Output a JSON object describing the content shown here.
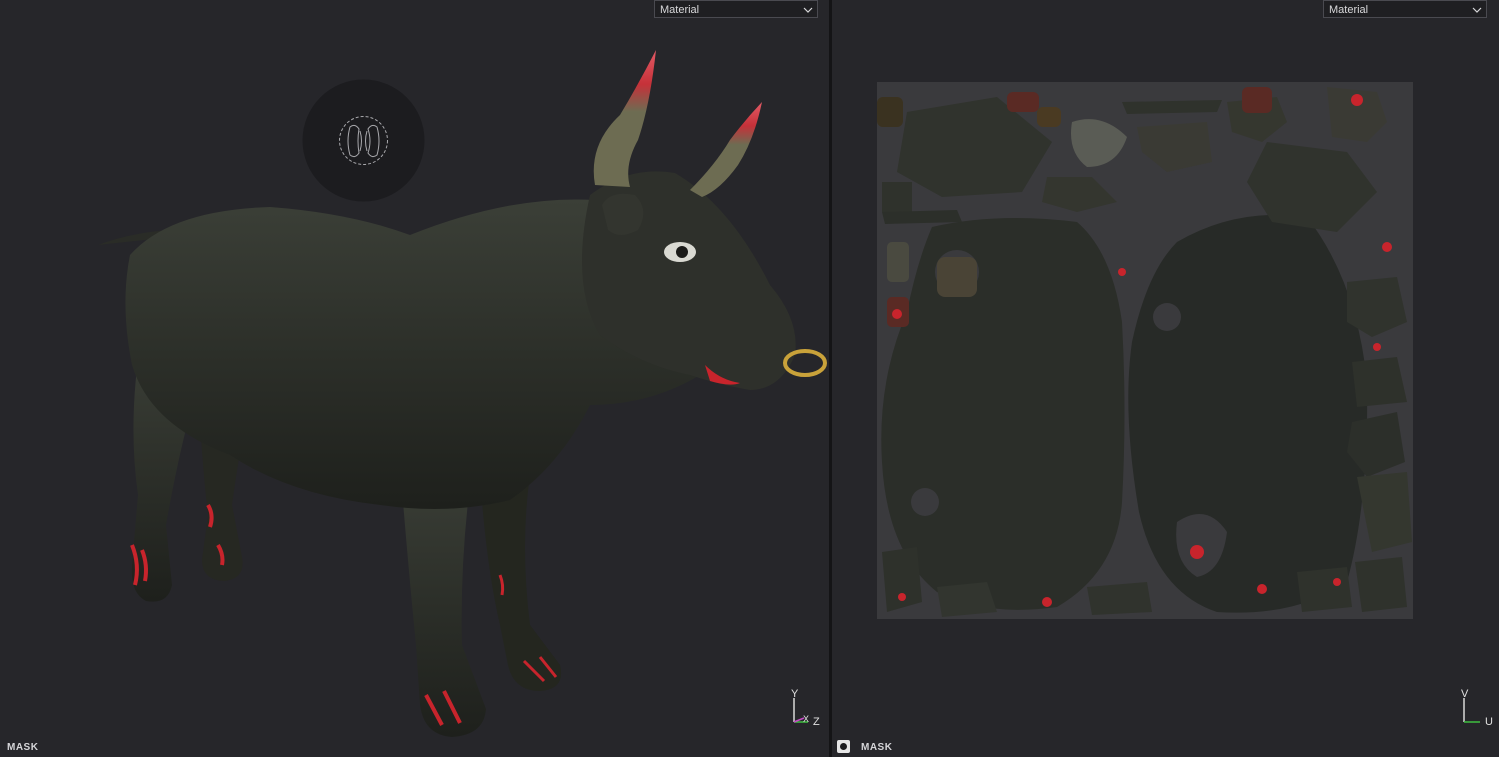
{
  "viewports": {
    "model3d": {
      "mode_select": {
        "value": "Material"
      },
      "mask_label": "MASK",
      "axes": {
        "y": "Y",
        "x": "X",
        "z": "Z"
      }
    },
    "uv2d": {
      "mode_select": {
        "value": "Material"
      },
      "mask_label": "MASK",
      "axes": {
        "v": "V",
        "u": "U"
      }
    }
  },
  "icons": {
    "select_chevron": "chevron-down-icon",
    "brush_cursor": "brush-cursor-icon",
    "mask_toggle": "mask-toggle-icon",
    "axis_gizmo": "axis-gizmo-icon"
  },
  "colors": {
    "background": "#26262a",
    "model_base": "#2c2e28",
    "paint_accent": "#c8242c",
    "ring_gold": "#c9a23a",
    "axis_y": "#d8d8d8",
    "axis_x": "#c44cc4",
    "axis_z": "#3fbf3f"
  }
}
